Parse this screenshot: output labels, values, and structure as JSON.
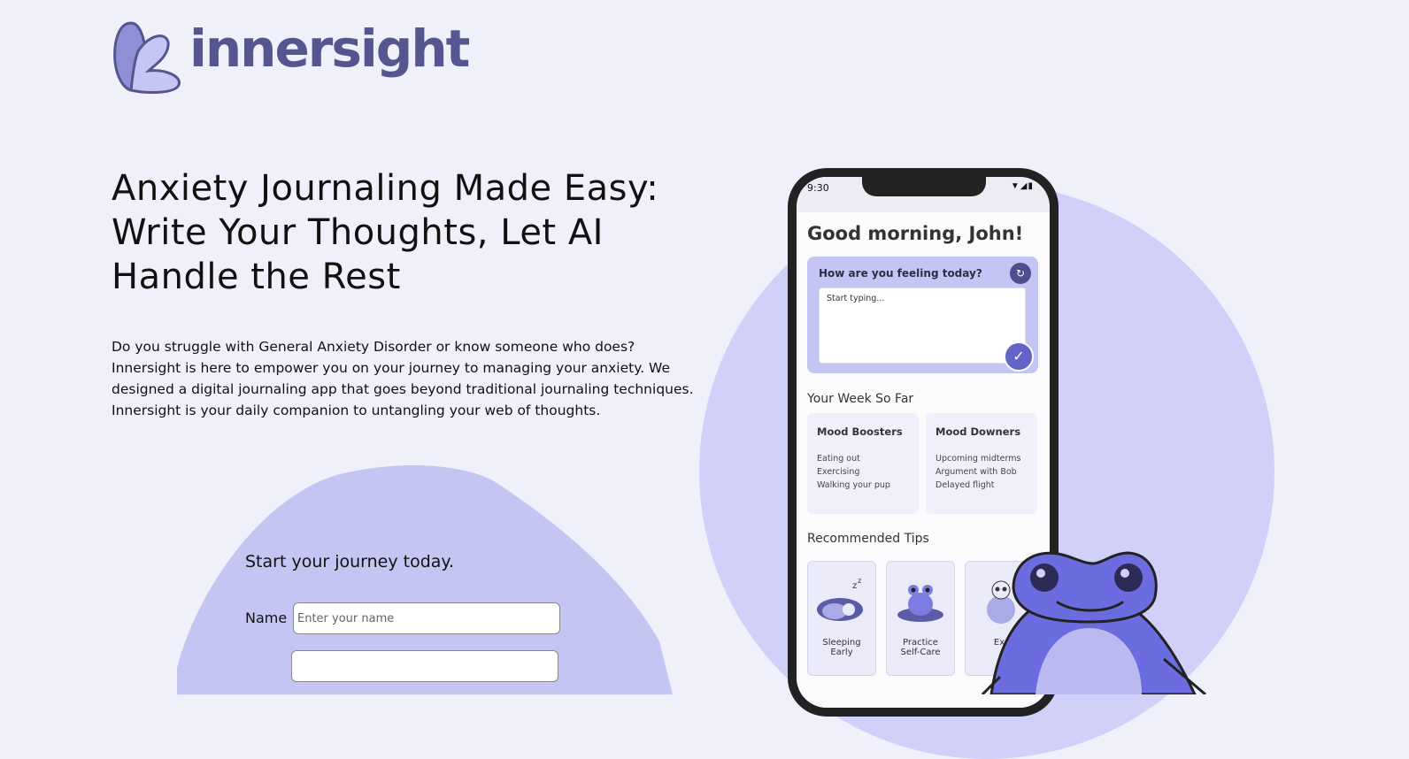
{
  "brand": {
    "name": "innersight",
    "logo_color": "#55558f"
  },
  "hero": {
    "headline_line1": "Anxiety Journaling Made Easy:",
    "headline_line2": "Write Your Thoughts, Let AI",
    "headline_line3": "Handle the Rest",
    "intro_line1": "Do you struggle with General Anxiety Disorder or know someone who does?",
    "intro_line2": "Innersight is here to empower you on your journey to managing your anxiety. We",
    "intro_line3": "designed a digital journaling app that goes beyond traditional journaling techniques.",
    "intro_line4": "Innersight is your daily companion to untangling your web of thoughts."
  },
  "signup": {
    "title": "Start your journey today.",
    "name_label": "Name",
    "name_placeholder": "Enter your name",
    "name_value": ""
  },
  "phone": {
    "status_time": "9:30",
    "status_icons": "▼◢▮",
    "greeting": "Good morning, John!",
    "feeling_question": "How are you feeling today?",
    "feeling_placeholder": "Start typing...",
    "refresh_icon": "refresh-icon",
    "submit_icon": "check-icon",
    "week_heading": "Your Week So Far",
    "mood_boosters": {
      "title": "Mood Boosters",
      "items": [
        "Eating out",
        "Exercising",
        "Walking your pup"
      ]
    },
    "mood_downers": {
      "title": "Mood Downers",
      "items": [
        "Upcoming midterms",
        "Argument with Bob",
        "Delayed flight"
      ]
    },
    "tips_heading": "Recommended Tips",
    "tips": [
      {
        "label_line1": "Sleeping",
        "label_line2": "Early"
      },
      {
        "label_line1": "Practice",
        "label_line2": "Self-Care"
      },
      {
        "label_line1": "Ex",
        "label_line2": ""
      }
    ]
  },
  "colors": {
    "background": "#f0f0fa",
    "accent": "#6264c8",
    "circle": "#d0d0f8",
    "blob": "#c5c5f3"
  }
}
